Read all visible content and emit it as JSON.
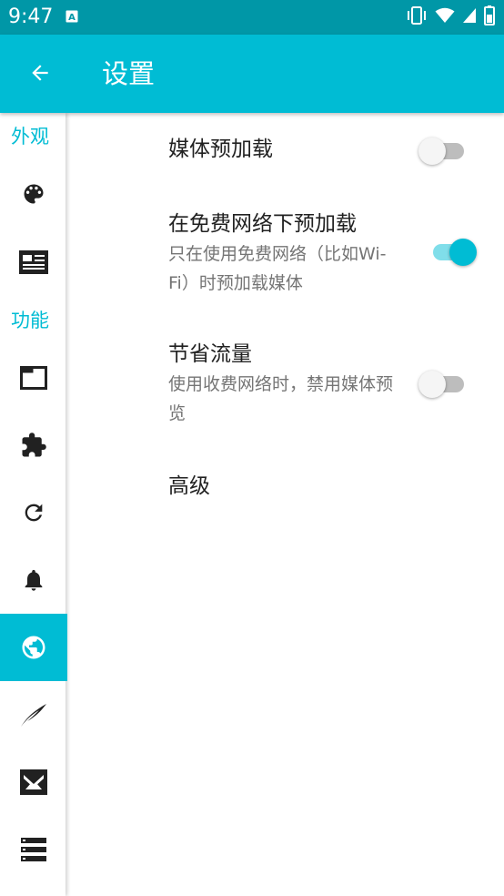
{
  "status_bar": {
    "time": "9:47",
    "notification_icon": "a-icon",
    "right_icons": [
      "vibrate-icon",
      "wifi-icon",
      "signal-icon",
      "battery-icon"
    ]
  },
  "app_bar": {
    "back_icon": "arrow-back-icon",
    "title": "设置"
  },
  "sidebar": {
    "section_appearance": "外观",
    "section_features": "功能",
    "items": [
      {
        "icon": "palette-icon",
        "active": false
      },
      {
        "icon": "article-icon",
        "active": false
      },
      {
        "icon": "tab-icon",
        "active": false
      },
      {
        "icon": "extension-icon",
        "active": false
      },
      {
        "icon": "refresh-icon",
        "active": false
      },
      {
        "icon": "notification-bell-icon",
        "active": false
      },
      {
        "icon": "globe-icon",
        "active": true
      },
      {
        "icon": "feather-icon",
        "active": false
      },
      {
        "icon": "email-icon",
        "active": false
      },
      {
        "icon": "storage-icon",
        "active": false
      }
    ]
  },
  "preferences": [
    {
      "title": "媒体预加载",
      "summary": "",
      "switch": "off"
    },
    {
      "title": "在免费网络下预加载",
      "summary": "只在使用免费网络（比如Wi-Fi）时预加载媒体",
      "switch": "on"
    },
    {
      "title": "节省流量",
      "summary": "使用收费网络时，禁用媒体预览",
      "switch": "off"
    },
    {
      "title": "高级",
      "summary": ""
    }
  ],
  "colors": {
    "primary": "#00bcd4",
    "primary_dark": "#0097a7",
    "switch_on_track": "#80deea",
    "text_primary": "#212121",
    "text_secondary": "#757575"
  }
}
